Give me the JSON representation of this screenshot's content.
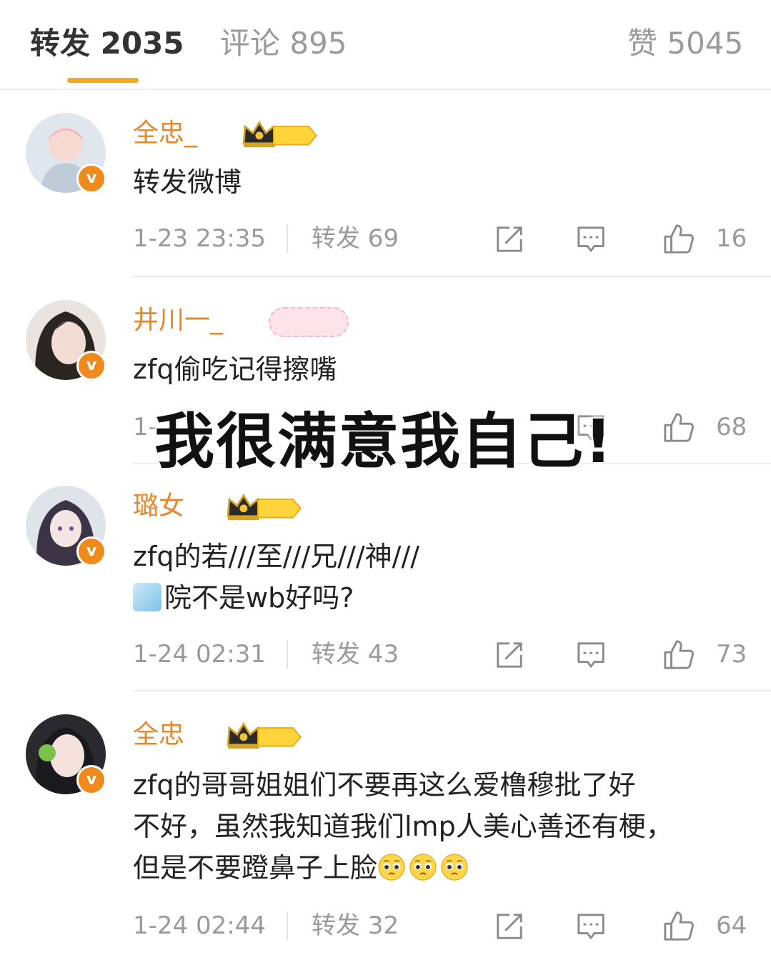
{
  "tabs": [
    {
      "label": "转发 2035"
    },
    {
      "label": "评论 895"
    },
    {
      "label": "赞 5045"
    }
  ],
  "accent_color": "#f5a623",
  "username_color": "#e8862a",
  "overlay_text": "我很满意我自己!",
  "comments": [
    {
      "username": "全忠_",
      "badge_level": "I",
      "text": "转发微博",
      "time": "1-23 23:35",
      "repost": "转发 69",
      "likes": "16"
    },
    {
      "username": "井川一_",
      "badge_level": "I",
      "text": "zfq偷吃记得擦嘴",
      "time": "1-",
      "repost": "",
      "likes": "68"
    },
    {
      "username": "璐女",
      "badge_level": "II",
      "text_line1": "zfq的若///至///兄///神///",
      "text_line2": "院不是wb好吗?",
      "time": "1-24 02:31",
      "repost": "转发 43",
      "likes": "73"
    },
    {
      "username": "全忠",
      "badge_level": "I",
      "text_line1": "zfq的哥哥姐姐们不要再这么爱橹穆批了好",
      "text_line2": "不好，虽然我知道我们lmp人美心善还有梗，",
      "text_line3": "但是不要蹬鼻子上脸",
      "time": "1-24 02:44",
      "repost": "转发 32",
      "likes": "64"
    }
  ],
  "icons": {
    "repost": "edit-square-icon",
    "comment": "comment-bubble-icon",
    "like": "thumbs-up-icon",
    "verified": "v-badge-icon",
    "crown": "crown-badge-icon",
    "emoji": "pleading-face-emoji"
  }
}
